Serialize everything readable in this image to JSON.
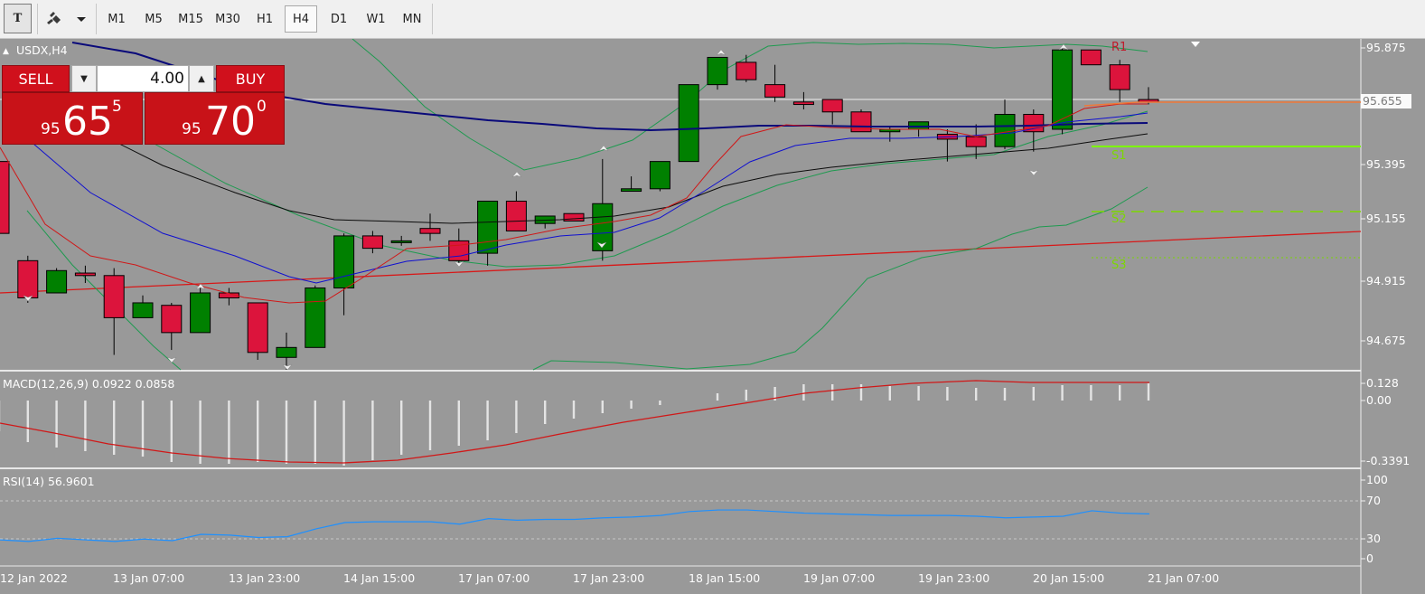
{
  "toolbar": {
    "text_tool": "T",
    "timeframes": [
      {
        "label": "M1",
        "active": false
      },
      {
        "label": "M5",
        "active": false
      },
      {
        "label": "M15",
        "active": false
      },
      {
        "label": "M30",
        "active": false
      },
      {
        "label": "H1",
        "active": false
      },
      {
        "label": "H4",
        "active": true
      },
      {
        "label": "D1",
        "active": false
      },
      {
        "label": "W1",
        "active": false
      },
      {
        "label": "MN",
        "active": false
      }
    ]
  },
  "chart": {
    "title": "USDX,H4",
    "current_price_tag": "95.655",
    "price_axis": [
      "95.875",
      "95.395",
      "95.155",
      "94.915",
      "94.675"
    ],
    "pivot_labels": [
      "R1",
      "S1",
      "S2",
      "S3"
    ],
    "time_labels": [
      "12 Jan 2022",
      "13 Jan 07:00",
      "13 Jan 23:00",
      "14 Jan 15:00",
      "17 Jan 07:00",
      "17 Jan 23:00",
      "18 Jan 15:00",
      "19 Jan 07:00",
      "19 Jan 23:00",
      "20 Jan 15:00",
      "21 Jan 07:00"
    ]
  },
  "trade_panel": {
    "sell_label": "SELL",
    "buy_label": "BUY",
    "volume": "4.00",
    "sell_price": {
      "prefix": "95",
      "big": "65",
      "sup": "5"
    },
    "buy_price": {
      "prefix": "95",
      "big": "70",
      "sup": "0"
    }
  },
  "macd": {
    "label": "MACD(12,26,9) 0.0922 0.0858",
    "axis": [
      "0.128",
      "0.00",
      "-0.3391"
    ]
  },
  "rsi": {
    "label": "RSI(14) 56.9601",
    "axis": [
      "100",
      "70",
      "30",
      "0"
    ]
  },
  "colors": {
    "bull": "#008000",
    "bear": "#dc143c",
    "background": "#999999",
    "trade_red": "#c81218"
  },
  "chart_data": {
    "type": "candlestick",
    "symbol": "USDX",
    "timeframe": "H4",
    "candles": [
      {
        "o": 95.42,
        "h": 95.48,
        "l": 95.13,
        "c": 95.13
      },
      {
        "o": 95.02,
        "h": 95.04,
        "l": 94.85,
        "c": 94.87
      },
      {
        "o": 94.89,
        "h": 94.99,
        "l": 94.89,
        "c": 94.98
      },
      {
        "o": 94.97,
        "h": 95.0,
        "l": 94.93,
        "c": 94.96
      },
      {
        "o": 94.96,
        "h": 94.99,
        "l": 94.64,
        "c": 94.79
      },
      {
        "o": 94.79,
        "h": 94.88,
        "l": 94.79,
        "c": 94.85
      },
      {
        "o": 94.84,
        "h": 94.85,
        "l": 94.66,
        "c": 94.73
      },
      {
        "o": 94.73,
        "h": 94.91,
        "l": 94.73,
        "c": 94.89
      },
      {
        "o": 94.89,
        "h": 94.91,
        "l": 94.84,
        "c": 94.87
      },
      {
        "o": 94.85,
        "h": 94.85,
        "l": 94.62,
        "c": 94.65
      },
      {
        "o": 94.63,
        "h": 94.73,
        "l": 94.58,
        "c": 94.67
      },
      {
        "o": 94.67,
        "h": 94.92,
        "l": 94.67,
        "c": 94.91
      },
      {
        "o": 94.91,
        "h": 95.13,
        "l": 94.8,
        "c": 95.12
      },
      {
        "o": 95.12,
        "h": 95.14,
        "l": 95.05,
        "c": 95.07
      },
      {
        "o": 95.1,
        "h": 95.12,
        "l": 95.08,
        "c": 95.1
      },
      {
        "o": 95.15,
        "h": 95.21,
        "l": 95.1,
        "c": 95.13
      },
      {
        "o": 95.1,
        "h": 95.15,
        "l": 95.0,
        "c": 95.02
      },
      {
        "o": 95.05,
        "h": 95.26,
        "l": 95.0,
        "c": 95.26
      },
      {
        "o": 95.26,
        "h": 95.3,
        "l": 95.16,
        "c": 95.14
      },
      {
        "o": 95.17,
        "h": 95.2,
        "l": 95.15,
        "c": 95.2
      },
      {
        "o": 95.21,
        "h": 95.21,
        "l": 95.18,
        "c": 95.18
      },
      {
        "o": 95.06,
        "h": 95.43,
        "l": 95.02,
        "c": 95.25
      },
      {
        "o": 95.3,
        "h": 95.36,
        "l": 95.3,
        "c": 95.31
      },
      {
        "o": 95.31,
        "h": 95.41,
        "l": 95.3,
        "c": 95.42
      },
      {
        "o": 95.42,
        "h": 95.73,
        "l": 95.42,
        "c": 95.73
      },
      {
        "o": 95.73,
        "h": 95.84,
        "l": 95.71,
        "c": 95.84
      },
      {
        "o": 95.82,
        "h": 95.85,
        "l": 95.74,
        "c": 95.75
      },
      {
        "o": 95.73,
        "h": 95.81,
        "l": 95.66,
        "c": 95.68
      },
      {
        "o": 95.66,
        "h": 95.7,
        "l": 95.63,
        "c": 95.65
      },
      {
        "o": 95.67,
        "h": 95.67,
        "l": 95.57,
        "c": 95.62
      },
      {
        "o": 95.62,
        "h": 95.63,
        "l": 95.54,
        "c": 95.54
      },
      {
        "o": 95.54,
        "h": 95.56,
        "l": 95.5,
        "c": 95.55
      },
      {
        "o": 95.55,
        "h": 95.58,
        "l": 95.52,
        "c": 95.58
      },
      {
        "o": 95.53,
        "h": 95.55,
        "l": 95.42,
        "c": 95.51
      },
      {
        "o": 95.52,
        "h": 95.57,
        "l": 95.43,
        "c": 95.48
      },
      {
        "o": 95.48,
        "h": 95.67,
        "l": 95.47,
        "c": 95.61
      },
      {
        "o": 95.61,
        "h": 95.63,
        "l": 95.46,
        "c": 95.54
      },
      {
        "o": 95.55,
        "h": 95.88,
        "l": 95.53,
        "c": 95.87
      },
      {
        "o": 95.87,
        "h": 95.87,
        "l": 95.81,
        "c": 95.81
      },
      {
        "o": 95.81,
        "h": 95.83,
        "l": 95.66,
        "c": 95.71
      },
      {
        "o": 95.67,
        "h": 95.72,
        "l": 95.65,
        "c": 95.66
      }
    ],
    "ylim": [
      94.58,
      95.9
    ],
    "pivot_levels": {
      "R1": 95.92,
      "S1": 95.475,
      "S2": 95.2,
      "S3": 95.0
    },
    "macd_range": [
      -0.3391,
      0.128
    ],
    "rsi_range": [
      0,
      100
    ],
    "rsi_levels": [
      70,
      30
    ],
    "rsi_values": [
      24,
      22,
      26,
      24,
      22,
      25,
      23,
      31,
      30,
      27,
      28,
      38,
      46,
      47,
      47,
      47,
      44,
      51,
      49,
      50,
      50,
      52,
      53,
      55,
      60,
      62,
      62,
      60,
      58,
      57,
      56,
      55,
      55,
      55,
      54,
      52,
      53,
      54,
      61,
      58,
      57
    ]
  }
}
